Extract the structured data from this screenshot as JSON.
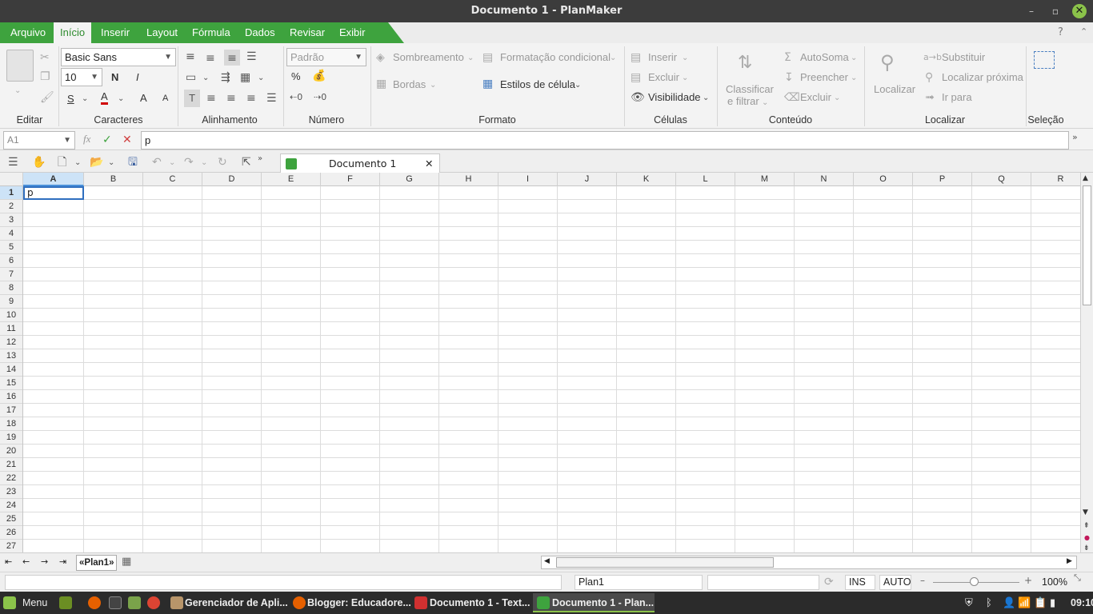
{
  "window": {
    "title": "Documento 1 - PlanMaker",
    "minimize": "–",
    "restore": "▫",
    "close": "✕"
  },
  "menu": [
    "Arquivo",
    "Início",
    "Inserir",
    "Layout",
    "Fórmula",
    "Dados",
    "Revisar",
    "Exibir"
  ],
  "menu_help": "?",
  "ribbon": {
    "font": {
      "name": "Basic Sans",
      "size": "10",
      "bold": "N",
      "italic": "I",
      "underline": "S",
      "color": "A",
      "grow": "A",
      "shrink": "A"
    },
    "number": {
      "format": "Padrão",
      "percent": "%"
    },
    "format": {
      "shading": "Sombreamento",
      "conditional": "Formatação condicional",
      "borders": "Bordas",
      "cell_styles": "Estilos de célula"
    },
    "cells": {
      "insert": "Inserir",
      "delete": "Excluir",
      "visibility": "Visibilidade"
    },
    "content": {
      "sort1": "Classificar",
      "sort2": "e filtrar",
      "autosum": "AutoSoma",
      "fill": "Preencher",
      "delete": "Excluir"
    },
    "find": {
      "find": "Localizar",
      "replace": "Substituir",
      "find_next": "Localizar próxima",
      "goto": "Ir para"
    },
    "groups": {
      "edit": "Editar",
      "chars": "Caracteres",
      "align": "Alinhamento",
      "number": "Número",
      "format": "Formato",
      "cells": "Células",
      "content": "Conteúdo",
      "find": "Localizar",
      "select": "Seleção"
    }
  },
  "formula_bar": {
    "cell_ref": "A1",
    "fx": "fx",
    "content": "p"
  },
  "doc_tab": {
    "title": "Documento 1"
  },
  "columns": [
    "A",
    "B",
    "C",
    "D",
    "E",
    "F",
    "G",
    "H",
    "I",
    "J",
    "K",
    "L",
    "M",
    "N",
    "O",
    "P",
    "Q",
    "R"
  ],
  "rows": [
    "1",
    "2",
    "3",
    "4",
    "5",
    "6",
    "7",
    "8",
    "9",
    "10",
    "11",
    "12",
    "13",
    "14",
    "15",
    "16",
    "17",
    "18",
    "19",
    "20",
    "21",
    "22",
    "23",
    "24",
    "25",
    "26",
    "27"
  ],
  "cell_a1": "p",
  "sheet_tab": "«Plan1»",
  "status": {
    "sheet": "Plan1",
    "ins": "INS",
    "auto": "AUTO",
    "zoom": "100%"
  },
  "taskbar": {
    "menu": "Menu",
    "apps": [
      "Gerenciador de Apli...",
      "Blogger: Educadore...",
      "Documento 1 - Text...",
      "Documento 1 - Plan..."
    ],
    "time": "09:10"
  },
  "colors": {
    "accent": "#3ea33e",
    "selection": "#2f6fbf"
  }
}
